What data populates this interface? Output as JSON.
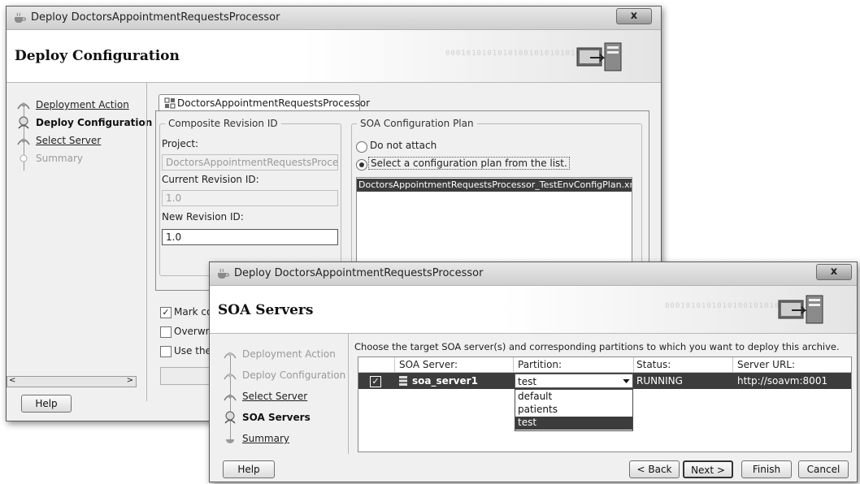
{
  "back_window": {
    "title": "Deploy DoctorsAppointmentRequestsProcessor",
    "close_label": "x",
    "header_title": "Deploy Configuration",
    "header_binary": "0001010101010100101010101010",
    "nav": [
      {
        "label": "Deployment Action",
        "state": "done"
      },
      {
        "label": "Deploy Configuration",
        "state": "current"
      },
      {
        "label": "Select Server",
        "state": "link"
      },
      {
        "label": "Summary",
        "state": "future"
      }
    ],
    "tab_label": "DoctorsAppointmentRequestsProcessor",
    "revision_group": {
      "legend": "Composite Revision ID",
      "project_label": "Project:",
      "project_value": "DoctorsAppointmentRequestsProcessor",
      "current_label": "Current Revision ID:",
      "current_value": "1.0",
      "new_label": "New Revision ID:",
      "new_value": "1.0"
    },
    "plan_group": {
      "legend": "SOA Configuration Plan",
      "do_not_attach": "Do not attach",
      "select_plan": "Select a configuration plan from the list.",
      "selected_option": "select_plan",
      "plans": [
        "DoctorsAppointmentRequestsProcessor_TestEnvConfigPlan.xml"
      ]
    },
    "options": [
      {
        "label": "Mark cor",
        "checked": true
      },
      {
        "label": "Overwri",
        "checked": false
      },
      {
        "label": "Use the",
        "checked": false
      }
    ],
    "help_label": "Help"
  },
  "front_window": {
    "title": "Deploy DoctorsAppointmentRequestsProcessor",
    "close_label": "x",
    "header_title": "SOA Servers",
    "header_binary": "0001010101010100101010101010",
    "nav": [
      {
        "label": "Deployment Action",
        "state": "future"
      },
      {
        "label": "Deploy Configuration",
        "state": "future"
      },
      {
        "label": "Select Server",
        "state": "link"
      },
      {
        "label": "SOA Servers",
        "state": "current"
      },
      {
        "label": "Summary",
        "state": "link"
      }
    ],
    "instruction": "Choose the target SOA server(s) and corresponding partitions to which you want to deploy this archive.",
    "table": {
      "columns": [
        "SOA Server:",
        "Partition:",
        "Status:",
        "Server URL:"
      ],
      "rows": [
        {
          "checked": true,
          "server": "soa_server1",
          "partition": "test",
          "status": "RUNNING",
          "url": "http://soavm:8001"
        }
      ]
    },
    "partition_options": [
      "default",
      "patients",
      "test"
    ],
    "highlighted_partition": "test",
    "buttons": {
      "help": "Help",
      "back": "< Back",
      "next": "Next >",
      "finish": "Finish",
      "cancel": "Cancel"
    }
  }
}
